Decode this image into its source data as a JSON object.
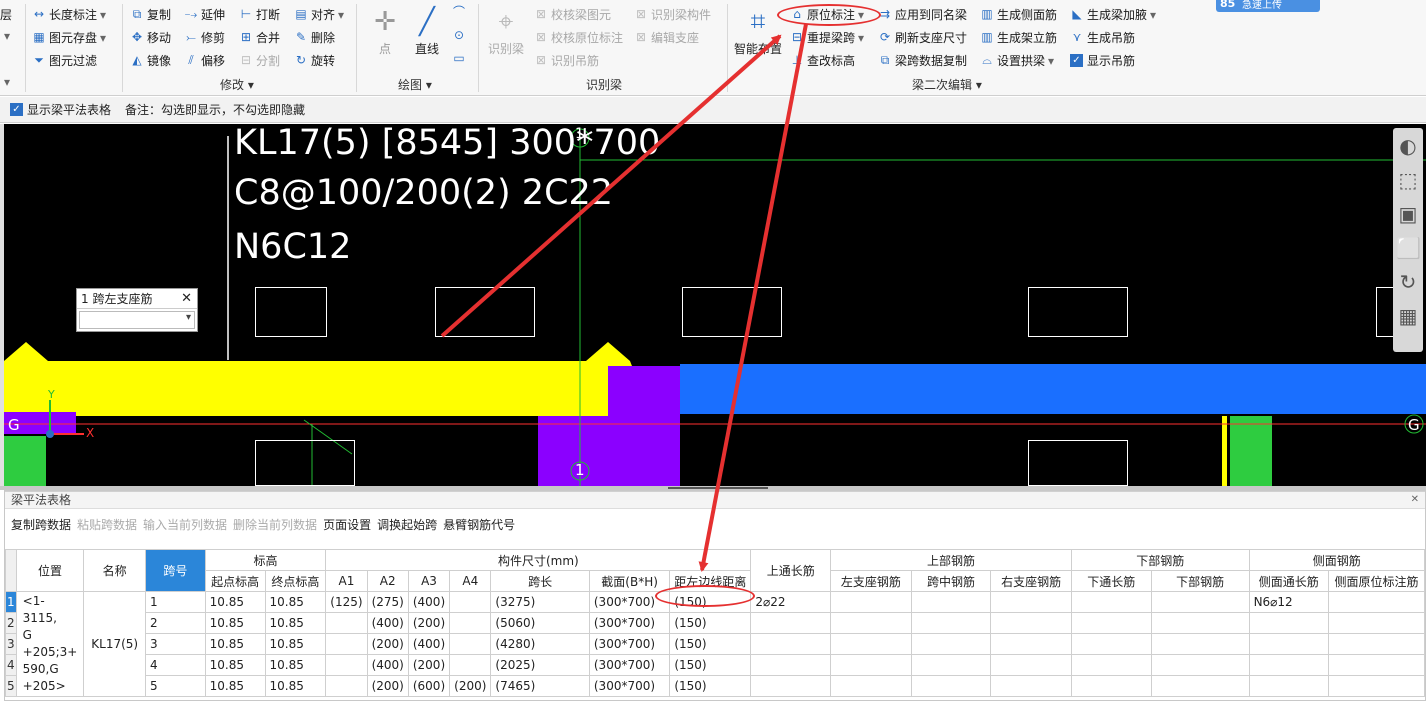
{
  "ribbon": {
    "col1": [
      "层",
      "",
      ""
    ],
    "measure": [
      "长度标注",
      "图元存盘",
      "图元过滤"
    ],
    "modify": {
      "row1": [
        "复制",
        "延伸",
        "打断",
        "对齐"
      ],
      "row2": [
        "移动",
        "修剪",
        "合并",
        "删除"
      ],
      "row3": [
        "镜像",
        "偏移",
        "分割",
        "旋转"
      ],
      "label": "修改"
    },
    "draw": {
      "point": "点",
      "line": "直线",
      "label": "绘图"
    },
    "identify": {
      "big": "识别梁",
      "items": [
        "校核梁图元",
        "识别梁构件",
        "校核原位标注",
        "编辑支座",
        "识别吊筋"
      ],
      "label": "识别梁"
    },
    "secondary": {
      "smart": "智能布置",
      "col1": [
        "原位标注",
        "重提梁跨",
        "查改标高"
      ],
      "col2": [
        "应用到同名梁",
        "刷新支座尺寸",
        "梁跨数据复制"
      ],
      "col3": [
        "生成侧面筋",
        "生成架立筋",
        "设置拱梁"
      ],
      "col4": [
        "生成梁加腋",
        "生成吊筋",
        "显示吊筋"
      ],
      "label": "梁二次编辑"
    },
    "upload": {
      "num": "85",
      "text": "急速上传"
    }
  },
  "options": {
    "show_table": "显示梁平法表格",
    "note": "备注：勾选即显示，不勾选即隐藏"
  },
  "canvas": {
    "beam_lines": [
      "KL17(5) [8545] 300*700",
      "C8@100/200(2) 2C22",
      "N6C12"
    ],
    "popup_title": "1 跨左支座筋",
    "axis_g": "G",
    "axis_1": "1",
    "axis_x": "X",
    "axis_y": "Y"
  },
  "panel": {
    "title": "梁平法表格",
    "tools": [
      "复制跨数据",
      "粘贴跨数据",
      "输入当前列数据",
      "删除当前列数据",
      "页面设置",
      "调换起始跨",
      "悬臂钢筋代号"
    ],
    "headers": {
      "pos": "位置",
      "name": "名称",
      "span": "跨号",
      "elev": "标高",
      "elev_start": "起点标高",
      "elev_end": "终点标高",
      "dims": "构件尺寸(mm)",
      "a1": "A1",
      "a2": "A2",
      "a3": "A3",
      "a4": "A4",
      "len": "跨长",
      "section": "截面(B*H)",
      "edge": "距左边线距离",
      "top_cont": "上通长筋",
      "top_bars": "上部钢筋",
      "left_sup": "左支座钢筋",
      "mid": "跨中钢筋",
      "right_sup": "右支座钢筋",
      "bot_bars": "下部钢筋",
      "bot_cont": "下通长筋",
      "bot": "下部钢筋",
      "side": "侧面钢筋",
      "side_cont": "侧面通长筋",
      "side_orig": "侧面原位标注筋"
    },
    "position": "<1-3115,G+205;3+590,G+205>",
    "position_lines": [
      "<1-3115,",
      "G",
      "+205;3+",
      "590,G",
      "+205>"
    ],
    "beam_name": "KL17(5)",
    "rows": [
      {
        "n": "1",
        "span": "1",
        "s": "10.85",
        "e": "10.85",
        "a1": "(125)",
        "a2": "(275)",
        "a3": "(400)",
        "a4": "",
        "len": "(3275)",
        "sec": "(300*700)",
        "edge": "(150)",
        "top": "2⌀22",
        "side": "N6⌀12"
      },
      {
        "n": "2",
        "span": "2",
        "s": "10.85",
        "e": "10.85",
        "a1": "",
        "a2": "(400)",
        "a3": "(200)",
        "a4": "",
        "len": "(5060)",
        "sec": "(300*700)",
        "edge": "(150)",
        "top": "",
        "side": ""
      },
      {
        "n": "3",
        "span": "3",
        "s": "10.85",
        "e": "10.85",
        "a1": "",
        "a2": "(200)",
        "a3": "(400)",
        "a4": "",
        "len": "(4280)",
        "sec": "(300*700)",
        "edge": "(150)",
        "top": "",
        "side": ""
      },
      {
        "n": "4",
        "span": "4",
        "s": "10.85",
        "e": "10.85",
        "a1": "",
        "a2": "(400)",
        "a3": "(200)",
        "a4": "",
        "len": "(2025)",
        "sec": "(300*700)",
        "edge": "(150)",
        "top": "",
        "side": ""
      },
      {
        "n": "5",
        "span": "5",
        "s": "10.85",
        "e": "10.85",
        "a1": "",
        "a2": "(200)",
        "a3": "(600)",
        "a4": "(200)",
        "len": "(7465)",
        "sec": "(300*700)",
        "edge": "(150)",
        "top": "",
        "side": ""
      }
    ]
  },
  "colors": {
    "accent": "#2b86d9",
    "beam_yellow": "#ffff00",
    "beam_blue": "#1a6fff",
    "column_purple": "#8b00ff",
    "column_green": "#2ecc40",
    "annotation_red": "#e53030"
  }
}
